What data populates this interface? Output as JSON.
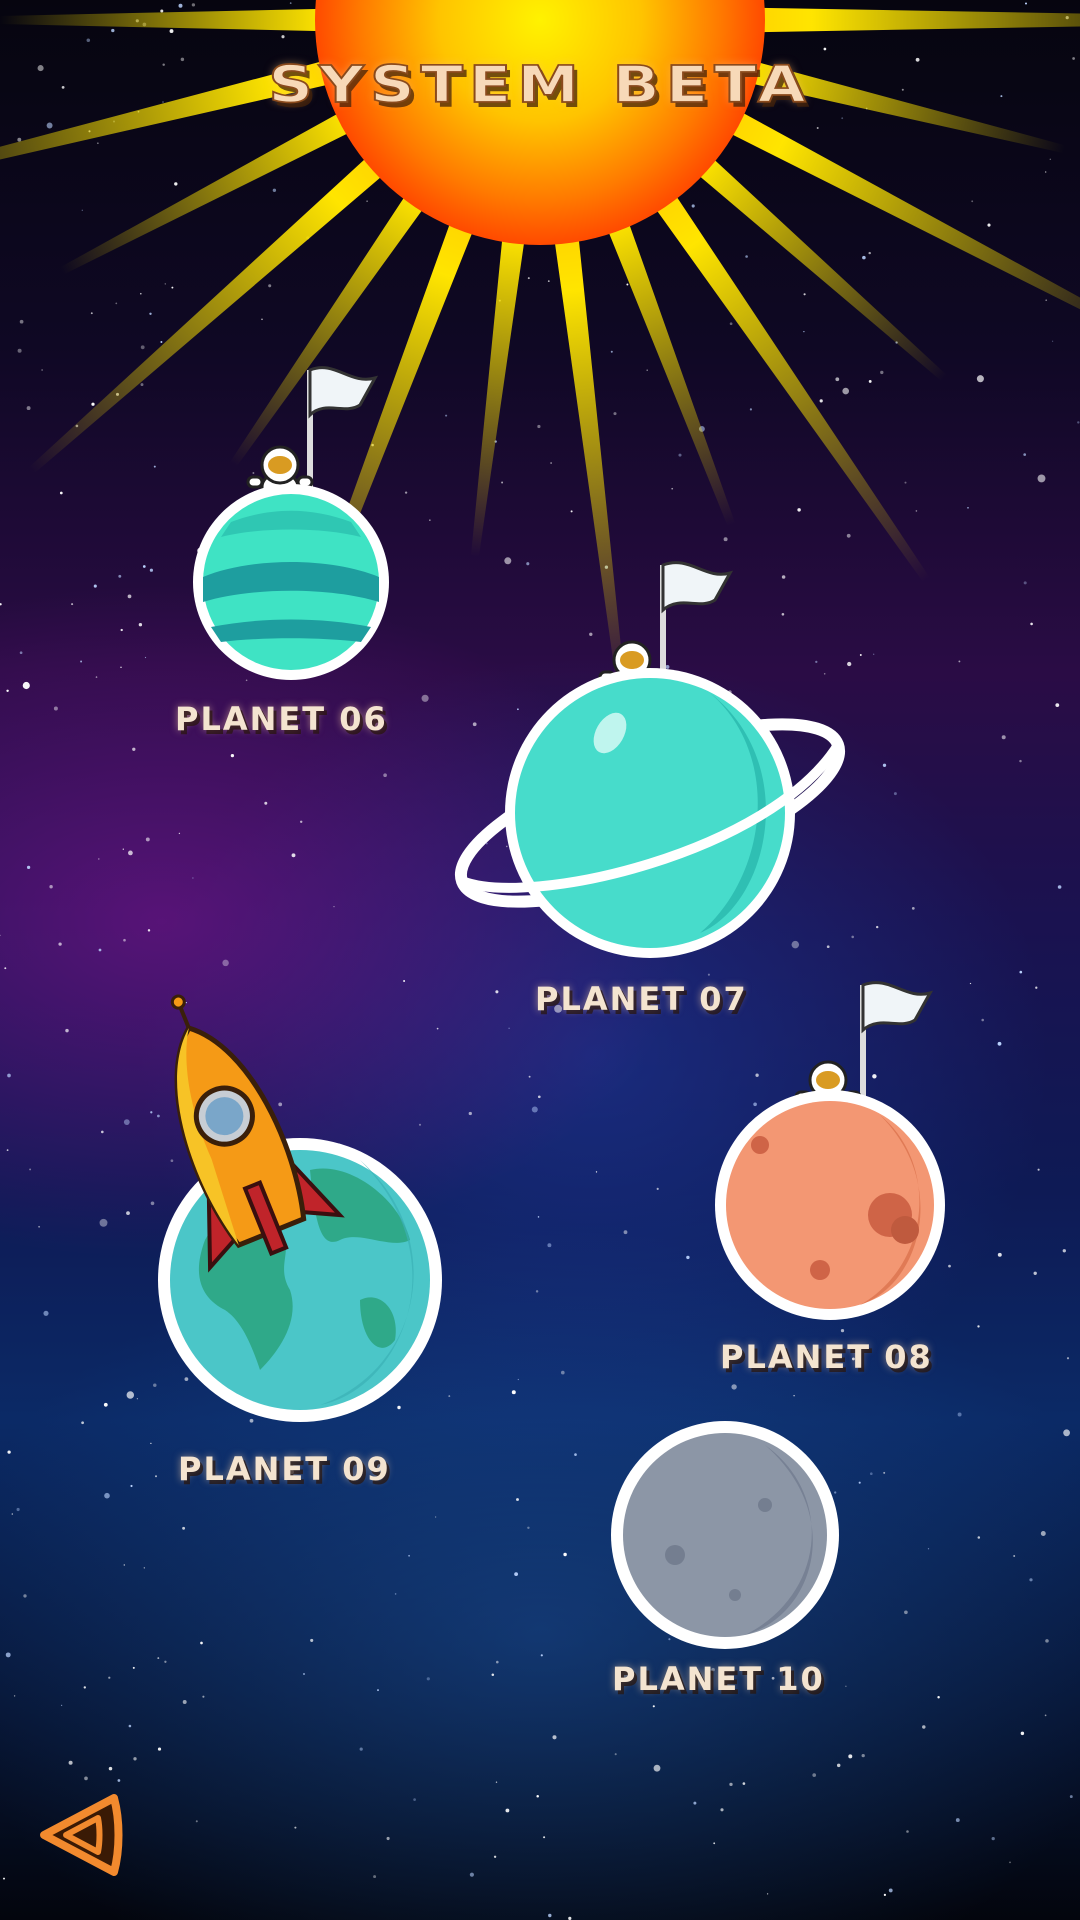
{
  "screen": {
    "title": "SYSTEM BETA"
  },
  "planets": [
    {
      "id": "06",
      "label": "PLANET 06",
      "style": "striped-teal",
      "status": "conquered",
      "marker": "astronaut-flag",
      "color": "#3fe3c4"
    },
    {
      "id": "07",
      "label": "PLANET 07",
      "style": "ringed-teal",
      "status": "conquered",
      "marker": "astronaut-flag",
      "color": "#4ad9c8"
    },
    {
      "id": "08",
      "label": "PLANET 08",
      "style": "cratered-orange",
      "status": "conquered",
      "marker": "astronaut-flag",
      "color": "#f39773"
    },
    {
      "id": "09",
      "label": "PLANET 09",
      "style": "earth-like",
      "status": "current",
      "marker": "rocket",
      "color": "#4bc6c8"
    },
    {
      "id": "10",
      "label": "PLANET 10",
      "style": "grey-moon",
      "status": "unvisited",
      "marker": "none",
      "color": "#8c96a6"
    }
  ],
  "navigation": {
    "back_icon": "back-triangle-icon",
    "accent": "#f28a2e"
  },
  "colors": {
    "sun_core": "#ffe600",
    "sun_edge": "#ff5a00",
    "space_top": "#06050f",
    "space_mid": "#2a0c45",
    "space_low": "#0b2a66"
  }
}
